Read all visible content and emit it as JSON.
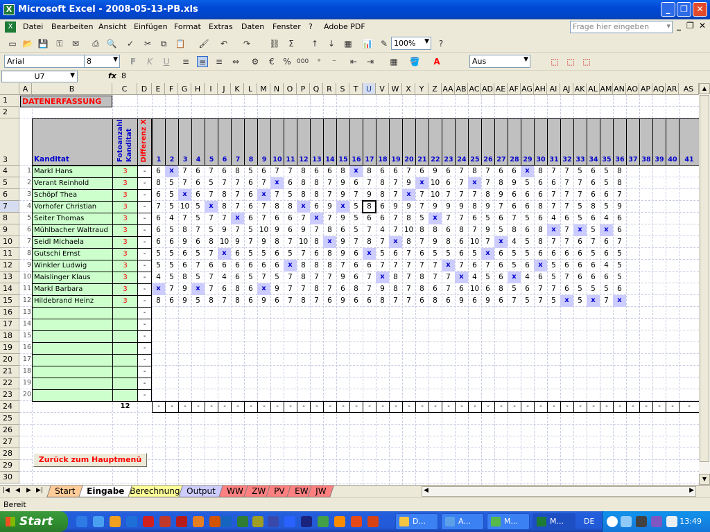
{
  "window": {
    "title": "Microsoft Excel - 2008-05-13-PB.xls"
  },
  "menu": {
    "items": [
      "Datei",
      "Bearbeiten",
      "Ansicht",
      "Einfügen",
      "Format",
      "Extras",
      "Daten",
      "Fenster",
      "?",
      "Adobe PDF"
    ],
    "ask_placeholder": "Frage hier eingeben"
  },
  "toolbar": {
    "zoom": "100%",
    "font": "Arial",
    "size": "8",
    "border_style": "Aus"
  },
  "formula_bar": {
    "cell": "U7",
    "fx": "fx",
    "value": "8"
  },
  "sheet": {
    "title": "DATENERFASSUNG",
    "hdr_kanditat": "Kanditat",
    "hdr_fotoanzahl": "Fotoanzahl Kanditat",
    "hdr_differenz": "Differenz X",
    "col_letters": [
      "A",
      "B",
      "C",
      "D",
      "E",
      "F",
      "G",
      "H",
      "I",
      "J",
      "K",
      "L",
      "M",
      "N",
      "O",
      "P",
      "Q",
      "R",
      "S",
      "T",
      "U",
      "V",
      "W",
      "X",
      "Y",
      "Z",
      "AA",
      "AB",
      "AC",
      "AD",
      "AE",
      "AF",
      "AG",
      "AH",
      "AI",
      "AJ",
      "AK",
      "AL",
      "AM",
      "AN",
      "AO",
      "AP",
      "AQ",
      "AR",
      "AS",
      "A"
    ],
    "photo_numbers": [
      "1",
      "2",
      "3",
      "4",
      "5",
      "6",
      "7",
      "8",
      "9",
      "10",
      "11",
      "12",
      "13",
      "14",
      "15",
      "16",
      "17",
      "18",
      "19",
      "20",
      "21",
      "22",
      "23",
      "24",
      "25",
      "26",
      "27",
      "28",
      "29",
      "30",
      "31",
      "32",
      "33",
      "34",
      "35",
      "36",
      "37",
      "38",
      "39",
      "40",
      "41",
      "4"
    ],
    "row_numbers": [
      "1",
      "2",
      "3",
      "4",
      "5",
      "6",
      "7",
      "8",
      "9",
      "10",
      "11",
      "12",
      "13",
      "14",
      "15",
      "16",
      "17",
      "18",
      "19",
      "20",
      "21",
      "22",
      "23",
      "24",
      "25",
      "26",
      "27",
      "28",
      "29",
      "30"
    ],
    "candidates": [
      {
        "nr": "1",
        "name": "Markl Hans",
        "count": "3",
        "diff": "-",
        "scores": [
          "6",
          "x",
          "7",
          "6",
          "7",
          "6",
          "8",
          "5",
          "6",
          "7",
          "7",
          "8",
          "6",
          "6",
          "8",
          "x",
          "8",
          "6",
          "6",
          "7",
          "6",
          "9",
          "6",
          "7",
          "8",
          "7",
          "6",
          "6",
          "x",
          "8",
          "7",
          "7",
          "5",
          "6",
          "5",
          "8"
        ]
      },
      {
        "nr": "2",
        "name": "Verant Reinhold",
        "count": "3",
        "diff": "-",
        "scores": [
          "8",
          "5",
          "7",
          "6",
          "5",
          "7",
          "7",
          "6",
          "7",
          "x",
          "6",
          "8",
          "8",
          "7",
          "9",
          "6",
          "7",
          "8",
          "7",
          "9",
          "x",
          "10",
          "6",
          "7",
          "x",
          "7",
          "8",
          "9",
          "5",
          "6",
          "6",
          "7",
          "7",
          "6",
          "5",
          "8"
        ]
      },
      {
        "nr": "3",
        "name": "Schöpf Thea",
        "count": "3",
        "diff": "-",
        "scores": [
          "6",
          "5",
          "x",
          "6",
          "7",
          "8",
          "7",
          "6",
          "x",
          "7",
          "5",
          "8",
          "8",
          "7",
          "9",
          "7",
          "9",
          "8",
          "7",
          "x",
          "7",
          "10",
          "7",
          "7",
          "7",
          "8",
          "9",
          "6",
          "6",
          "6",
          "7",
          "7",
          "7",
          "6",
          "6",
          "7"
        ]
      },
      {
        "nr": "4",
        "name": "Vorhofer Christian",
        "count": "3",
        "diff": "-",
        "scores": [
          "7",
          "5",
          "10",
          "5",
          "x",
          "8",
          "7",
          "6",
          "7",
          "8",
          "8",
          "x",
          "6",
          "9",
          "x",
          "5",
          "8",
          "6",
          "9",
          "9",
          "7",
          "9",
          "9",
          "9",
          "8",
          "9",
          "7",
          "6",
          "6",
          "8",
          "7",
          "7",
          "5",
          "8",
          "5",
          "9"
        ]
      },
      {
        "nr": "5",
        "name": "Seiter Thomas",
        "count": "3",
        "diff": "-",
        "scores": [
          "6",
          "4",
          "7",
          "5",
          "7",
          "7",
          "x",
          "6",
          "7",
          "6",
          "6",
          "7",
          "x",
          "7",
          "9",
          "5",
          "6",
          "6",
          "7",
          "8",
          "5",
          "x",
          "7",
          "7",
          "6",
          "5",
          "6",
          "7",
          "5",
          "6",
          "4",
          "6",
          "5",
          "6",
          "4",
          "6"
        ]
      },
      {
        "nr": "6",
        "name": "Mühlbacher Waltraud",
        "count": "3",
        "diff": "-",
        "scores": [
          "6",
          "5",
          "8",
          "7",
          "5",
          "9",
          "7",
          "5",
          "10",
          "9",
          "6",
          "9",
          "7",
          "8",
          "6",
          "5",
          "7",
          "4",
          "7",
          "10",
          "8",
          "8",
          "6",
          "8",
          "7",
          "9",
          "5",
          "8",
          "6",
          "8",
          "x",
          "7",
          "x",
          "5",
          "x",
          "6"
        ]
      },
      {
        "nr": "7",
        "name": "Seidl Michaela",
        "count": "3",
        "diff": "-",
        "scores": [
          "6",
          "6",
          "9",
          "6",
          "8",
          "10",
          "9",
          "7",
          "9",
          "8",
          "7",
          "10",
          "8",
          "x",
          "9",
          "7",
          "8",
          "7",
          "x",
          "8",
          "7",
          "9",
          "8",
          "6",
          "10",
          "7",
          "x",
          "4",
          "5",
          "8",
          "7",
          "7",
          "6",
          "7",
          "6",
          "7"
        ]
      },
      {
        "nr": "8",
        "name": "Gutschi Ernst",
        "count": "3",
        "diff": "-",
        "scores": [
          "5",
          "5",
          "6",
          "5",
          "7",
          "x",
          "6",
          "5",
          "5",
          "6",
          "5",
          "7",
          "6",
          "8",
          "9",
          "6",
          "x",
          "5",
          "6",
          "7",
          "6",
          "5",
          "5",
          "6",
          "5",
          "x",
          "6",
          "5",
          "5",
          "6",
          "6",
          "6",
          "6",
          "5",
          "6",
          "5"
        ]
      },
      {
        "nr": "9",
        "name": "Winkler Ludwig",
        "count": "3",
        "diff": "-",
        "scores": [
          "5",
          "5",
          "6",
          "7",
          "6",
          "6",
          "6",
          "6",
          "6",
          "6",
          "x",
          "8",
          "8",
          "8",
          "7",
          "6",
          "6",
          "7",
          "7",
          "7",
          "7",
          "7",
          "x",
          "7",
          "6",
          "7",
          "6",
          "5",
          "6",
          "x",
          "5",
          "6",
          "6",
          "6",
          "4",
          "5"
        ]
      },
      {
        "nr": "10",
        "name": "Maislinger Klaus",
        "count": "3",
        "diff": "-",
        "scores": [
          "4",
          "5",
          "8",
          "5",
          "7",
          "4",
          "6",
          "5",
          "7",
          "5",
          "7",
          "8",
          "7",
          "7",
          "9",
          "6",
          "7",
          "x",
          "8",
          "7",
          "8",
          "7",
          "7",
          "x",
          "4",
          "5",
          "6",
          "x",
          "4",
          "6",
          "5",
          "7",
          "6",
          "6",
          "6",
          "5"
        ]
      },
      {
        "nr": "11",
        "name": "Markl Barbara",
        "count": "3",
        "diff": "-",
        "scores": [
          "x",
          "7",
          "9",
          "x",
          "7",
          "6",
          "8",
          "6",
          "x",
          "9",
          "7",
          "7",
          "8",
          "7",
          "6",
          "8",
          "7",
          "9",
          "8",
          "7",
          "8",
          "6",
          "7",
          "6",
          "10",
          "6",
          "8",
          "5",
          "6",
          "7",
          "7",
          "6",
          "5",
          "5",
          "5",
          "6"
        ]
      },
      {
        "nr": "12",
        "name": "Hildebrand Heinz",
        "count": "3",
        "diff": "-",
        "scores": [
          "8",
          "6",
          "9",
          "5",
          "8",
          "7",
          "8",
          "6",
          "9",
          "6",
          "7",
          "8",
          "7",
          "6",
          "9",
          "6",
          "6",
          "8",
          "7",
          "7",
          "6",
          "8",
          "6",
          "9",
          "6",
          "9",
          "6",
          "7",
          "5",
          "7",
          "5",
          "x",
          "5",
          "x",
          "7",
          "x"
        ]
      },
      {
        "nr": "13",
        "name": "",
        "count": "",
        "diff": "-",
        "scores": []
      },
      {
        "nr": "14",
        "name": "",
        "count": "",
        "diff": "-",
        "scores": []
      },
      {
        "nr": "15",
        "name": "",
        "count": "",
        "diff": "-",
        "scores": []
      },
      {
        "nr": "16",
        "name": "",
        "count": "",
        "diff": "-",
        "scores": []
      },
      {
        "nr": "17",
        "name": "",
        "count": "",
        "diff": "-",
        "scores": []
      },
      {
        "nr": "18",
        "name": "",
        "count": "",
        "diff": "-",
        "scores": []
      },
      {
        "nr": "19",
        "name": "",
        "count": "",
        "diff": "-",
        "scores": []
      },
      {
        "nr": "20",
        "name": "",
        "count": "",
        "diff": "-",
        "scores": []
      }
    ],
    "total_count": "12",
    "total_dash": "-",
    "back_button": "Zurück zum Hauptmenü"
  },
  "tabs": [
    {
      "label": "Start",
      "color": "#FFCC99"
    },
    {
      "label": "Eingabe",
      "color": "#FFFFFF"
    },
    {
      "label": "Berechnung",
      "color": "#FFFF99"
    },
    {
      "label": "Output",
      "color": "#CCCCFF"
    },
    {
      "label": "WW",
      "color": "#FF8080"
    },
    {
      "label": "ZW",
      "color": "#FF8080"
    },
    {
      "label": "PV",
      "color": "#FF8080"
    },
    {
      "label": "EW",
      "color": "#FF8080"
    },
    {
      "label": "JW",
      "color": "#FF8080"
    }
  ],
  "status": {
    "text": "Bereit"
  },
  "taskbar": {
    "start": "Start",
    "buttons": [
      "D...",
      "A...",
      "M...",
      "M..."
    ],
    "lang": "DE",
    "clock": "13:49"
  },
  "colors": {
    "accent_blue": "#0000CC",
    "xmark_bg": "#CCCCFF",
    "name_bg": "#CCFFCC",
    "red": "#FF0000"
  }
}
